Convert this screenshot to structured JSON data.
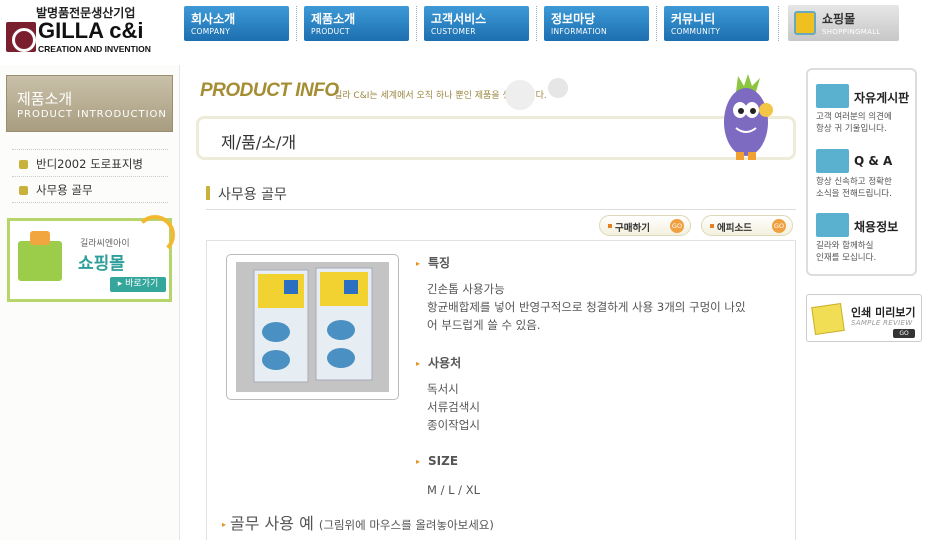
{
  "header": {
    "logo_korean": "발명품전문생산기업",
    "logo_brand": "GILLA c&i",
    "logo_sub": "CREATION AND INVENTION",
    "nav": [
      {
        "title": "회사소개",
        "en": "COMPANY"
      },
      {
        "title": "제품소개",
        "en": "PRODUCT"
      },
      {
        "title": "고객서비스",
        "en": "CUSTOMER"
      },
      {
        "title": "정보마당",
        "en": "INFORMATION"
      },
      {
        "title": "커뮤니티",
        "en": "COMMUNITY"
      }
    ],
    "shop": {
      "title": "쇼핑몰",
      "en": "SHOPPINGMALL"
    }
  },
  "sidebar": {
    "title": "제품소개",
    "title_en": "PRODUCT INTRODUCTION",
    "items": [
      {
        "label": "반디2002 도로표지병"
      },
      {
        "label": "사무용 골무"
      }
    ],
    "shop_banner": {
      "small": "길라씨엔아이",
      "big": "쇼핑몰",
      "go": "▸ 바로가기"
    }
  },
  "main": {
    "product_info": "PRODUCT INFO",
    "product_info_desc": "길라 C&I는 세계에서 오직 하나 뿐인 제품을 생산합니다.",
    "page_title": "제/품/소/개",
    "section_title": "사무용 골무",
    "buttons": {
      "buy": "구매하기",
      "episode": "에피소드",
      "go": "GO"
    },
    "features_heading": "특징",
    "features_text": [
      "긴손톱 사용가능",
      "항균배합제를 넣어 반영구적으로 청결하게 사용 3개의 구멍이 나있",
      "어 부드럽게 쓸 수 있음."
    ],
    "usage_heading": "사용처",
    "usage_text": [
      "독서시",
      "서류검색시",
      "종이작업시"
    ],
    "size_heading": "SIZE",
    "size_text": "M / L / XL",
    "usage_example": "골무 사용 예",
    "usage_example_note": "(그림위에 마우스를 올려놓아보세요)"
  },
  "rightbar": {
    "items": [
      {
        "title": "자유게시판",
        "desc": [
          "고객 여러분의 의견에",
          "항상 귀 기울입니다."
        ]
      },
      {
        "title": "Q & A",
        "desc": [
          "항상 신속하고 정확한",
          "소식을 전해드립니다."
        ]
      },
      {
        "title": "채용정보",
        "desc": [
          "길라와 함께하실",
          "인재를 모십니다."
        ]
      }
    ],
    "print": {
      "title": "인쇄 미리보기",
      "en": "SAMPLE REVIEW",
      "go": "GO"
    }
  }
}
